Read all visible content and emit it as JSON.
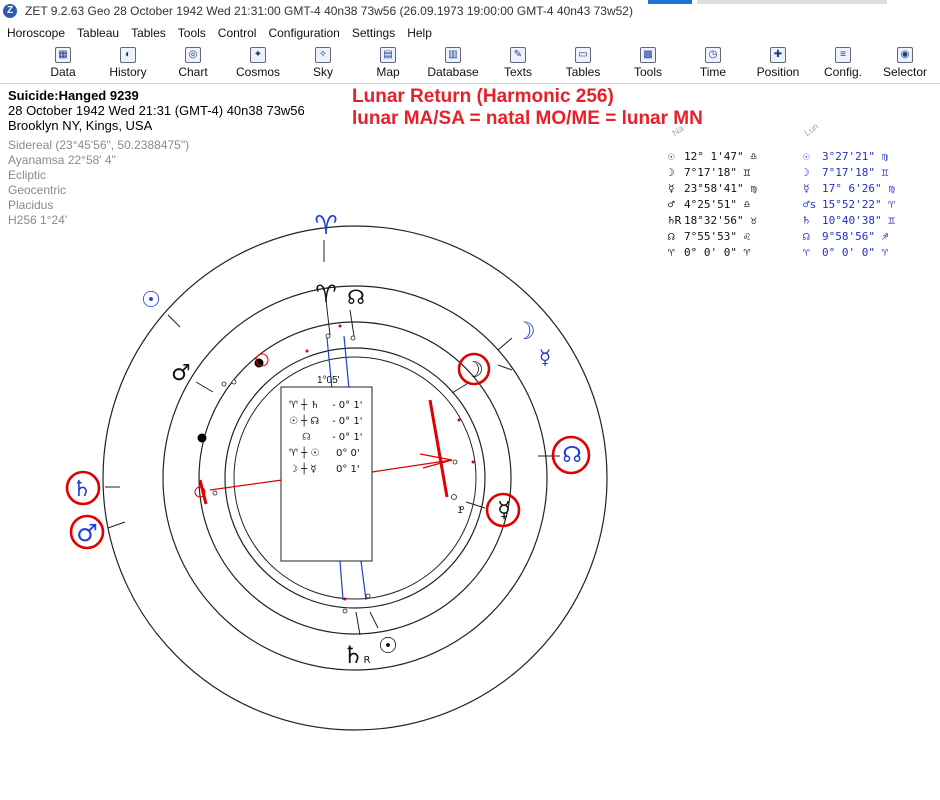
{
  "window": {
    "title": "ZET 9.2.63 Geo    28 October 1942  Wed  21:31:00 GMT-4 40n38  73w56   (26.09.1973  19:00:00 GMT-4 40n43 73w52)"
  },
  "menu": [
    "Horoscope",
    "Tableau",
    "Tables",
    "Tools",
    "Control",
    "Configuration",
    "Settings",
    "Help"
  ],
  "toolbar": [
    {
      "label": "Data",
      "icon": "data-icon"
    },
    {
      "label": "History",
      "icon": "history-icon"
    },
    {
      "label": "Chart",
      "icon": "chart-icon"
    },
    {
      "label": "Cosmos",
      "icon": "cosmos-icon"
    },
    {
      "label": "Sky",
      "icon": "sky-icon"
    },
    {
      "label": "Map",
      "icon": "map-icon"
    },
    {
      "label": "Database",
      "icon": "database-icon"
    },
    {
      "label": "Texts",
      "icon": "texts-icon"
    },
    {
      "label": "Tables",
      "icon": "tables-icon"
    },
    {
      "label": "Tools",
      "icon": "tools-icon"
    },
    {
      "label": "Time",
      "icon": "time-icon"
    },
    {
      "label": "Position",
      "icon": "position-icon"
    },
    {
      "label": "Config.",
      "icon": "config-icon"
    },
    {
      "label": "Selector",
      "icon": "selector-icon"
    }
  ],
  "horoscope": {
    "name": "Suicide:Hanged 9239",
    "datetime": "28 October 1942  Wed  21:31 (GMT-4)  40n38  73w56",
    "place": "Brooklyn NY, Kings, USA",
    "settings": [
      "Sidereal (23°45'56\", 50.2388475\")",
      "Ayanamsa 22°58' 4\"",
      "Ecliptic",
      "Geocentric",
      "Placidus",
      "H256   1°24'"
    ]
  },
  "annotation": {
    "line1": "Lunar Return (Harmonic 256)",
    "line2": "lunar MA/SA = natal MO/ME = lunar MN"
  },
  "table_heads": {
    "natal": "Na",
    "lunar": "Lun"
  },
  "positions": [
    {
      "n_glyph": "☉",
      "n_val": "12° 1'47\" ♎",
      "l_glyph": "☉",
      "l_val": "3°27'21\" ♍"
    },
    {
      "n_glyph": "☽",
      "n_val": " 7°17'18\" ♊",
      "l_glyph": "☽",
      "l_val": "7°17'18\" ♊"
    },
    {
      "n_glyph": "☿",
      "n_val": "23°58'41\" ♍",
      "l_glyph": "☿",
      "l_val": "17° 6'26\" ♍"
    },
    {
      "n_glyph": "♂",
      "n_val": " 4°25'51\" ♎",
      "l_glyph": "♂s",
      "l_val": "15°52'22\" ♈"
    },
    {
      "n_glyph": "♄R",
      "n_val": "18°32'56\" ♉",
      "l_glyph": "♄",
      "l_val": "10°40'38\" ♊"
    },
    {
      "n_glyph": "☊",
      "n_val": " 7°55'53\" ♌",
      "l_glyph": "☊",
      "l_val": "9°58'56\" ♐"
    },
    {
      "n_glyph": "♈",
      "n_val": " 0° 0' 0\" ♈",
      "l_glyph": "♈",
      "l_val": "0° 0' 0\" ♈"
    }
  ],
  "aspect_box": {
    "title": "1°05'",
    "rows": [
      {
        "label": "♈ ┼ ♄",
        "val": "- 0° 1'"
      },
      {
        "label": "☉ ┼ ☊",
        "val": "- 0° 1'"
      },
      {
        "label": "☊",
        "val": "- 0° 1'"
      },
      {
        "label": "♈ ┼ ☉",
        "val": "0° 0'"
      },
      {
        "label": "☽ ┼ ☿",
        "val": "0° 1'"
      }
    ]
  },
  "chart_glyphs": {
    "outer_aries": "♈",
    "outer_sun": "☉",
    "outer_moon": "☽",
    "outer_mercury": "☿",
    "outer_node": "☊",
    "outer_saturn": "♄",
    "outer_mars": "♂",
    "inner_aries": "♈",
    "inner_node": "☊",
    "inner_mars": "♂",
    "inner_moon": "☽",
    "inner_node_right": "☊",
    "inner_mercury": "☿",
    "inner_saturn": "♄",
    "inner_saturn_retro": "R",
    "inner_sun": "☉",
    "cusp_label": "1"
  },
  "colors": {
    "annotation_red": "#e8202a",
    "lunar_blue": "#2130c8",
    "highlight_red": "#e00000"
  }
}
